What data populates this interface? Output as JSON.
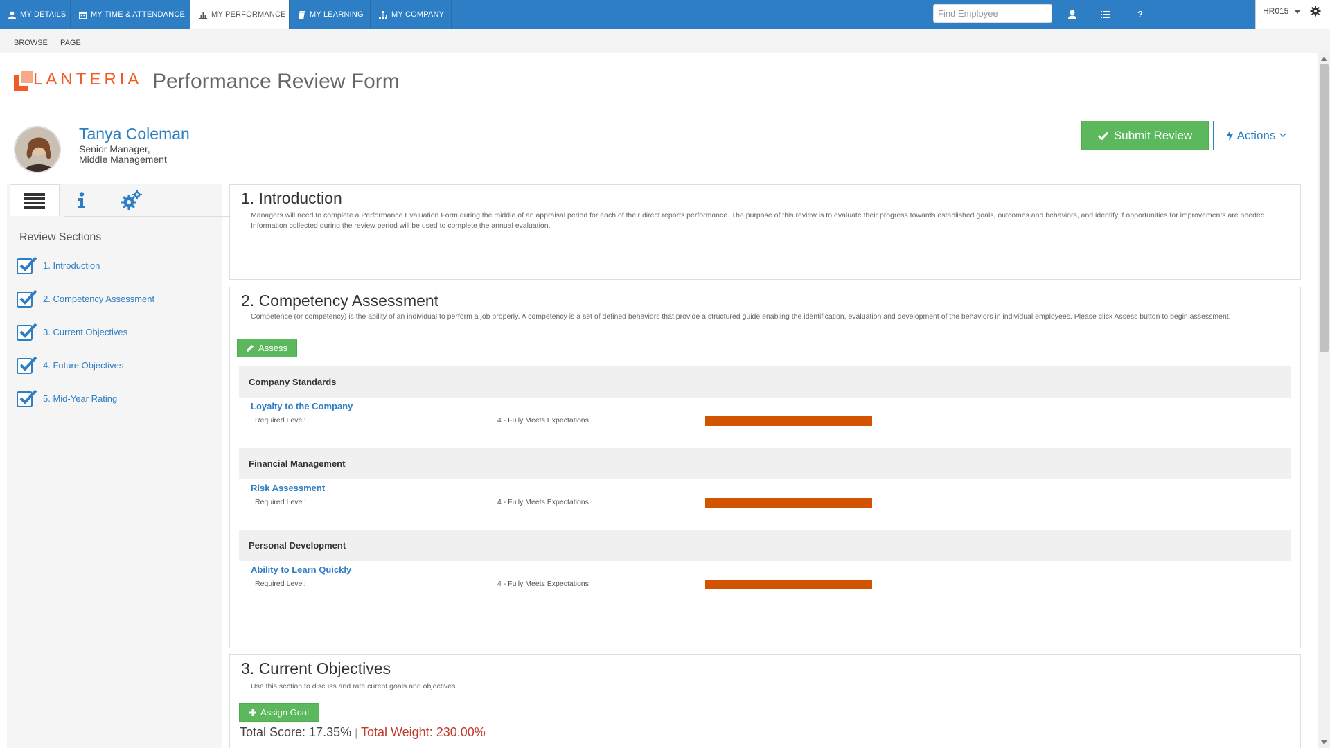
{
  "topnav": {
    "tabs": [
      {
        "label": "MY DETAILS",
        "icon": "user-icon"
      },
      {
        "label": "MY TIME & ATTENDANCE",
        "icon": "calendar-icon"
      },
      {
        "label": "MY PERFORMANCE",
        "icon": "bar-chart-icon",
        "active": true
      },
      {
        "label": "MY LEARNING",
        "icon": "book-icon"
      },
      {
        "label": "MY COMPANY",
        "icon": "sitemap-icon"
      }
    ],
    "search_placeholder": "Find Employee",
    "help_label": "?",
    "user_code": "HR015",
    "accent_color": "#2d7ec4"
  },
  "ribbon": {
    "tabs": [
      "BROWSE",
      "PAGE"
    ]
  },
  "header": {
    "logo": "LANTERIA",
    "page_title": "Performance Review Form",
    "logo_color": "#f15b25"
  },
  "employee": {
    "name": "Tanya Coleman",
    "title": "Senior Manager,",
    "level": "Middle Management"
  },
  "actions": {
    "submit_label": "Submit Review",
    "actions_label": "Actions",
    "submit_color": "#5cb85c"
  },
  "sidebar": {
    "tabs": [
      {
        "icon": "list-icon",
        "active": true
      },
      {
        "icon": "info-icon"
      },
      {
        "icon": "gears-icon"
      }
    ],
    "title": "Review Sections",
    "sections": [
      {
        "label": "1. Introduction",
        "checked": true
      },
      {
        "label": "2. Competency Assessment",
        "checked": true
      },
      {
        "label": "3. Current Objectives",
        "checked": true
      },
      {
        "label": "4. Future Objectives",
        "checked": true
      },
      {
        "label": "5. Mid-Year Rating",
        "checked": true
      }
    ]
  },
  "introduction": {
    "title": "1. Introduction",
    "text": "Managers will need to complete a Performance Evaluation Form during the middle of an appraisal period for each of their direct reports performance. The purpose of this review is to evaluate their progress towards established goals, outcomes and behaviors, and identify if opportunities for improvements are needed. Information collected during the review period will be used to complete the annual evaluation."
  },
  "competency": {
    "title": "2. Competency Assessment",
    "text": "Competence (or competency) is the ability of an individual to perform a job properly. A competency is a set of defined behaviors that provide a structured guide enabling the identification, evaluation and development of the behaviors in individual employees. Please click Assess button to begin assessment.",
    "assess_label": "Assess",
    "bar_color": "#d35400",
    "groups": [
      {
        "name": "Company Standards",
        "competency": "Loyalty to the Company",
        "required_label": "Required Level:",
        "required_value": "4 - Fully Meets Expectations"
      },
      {
        "name": "Financial Management",
        "competency": "Risk Assessment",
        "required_label": "Required Level:",
        "required_value": "4 - Fully Meets Expectations"
      },
      {
        "name": "Personal Development",
        "competency": "Ability to Learn Quickly",
        "required_label": "Required Level:",
        "required_value": "4 - Fully Meets Expectations"
      }
    ]
  },
  "objectives": {
    "title": "3. Current Objectives",
    "text": "Use this section to discuss and rate curent goals and objectives.",
    "assign_label": "Assign Goal",
    "total_score": "Total Score: 17.35%",
    "separator": "|",
    "total_weight": "Total Weight: 230.00%"
  }
}
